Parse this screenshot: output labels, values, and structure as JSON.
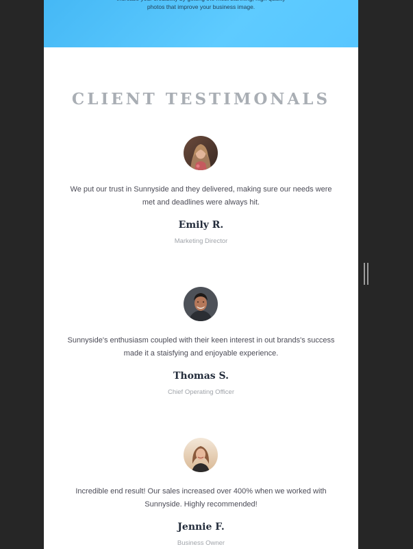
{
  "hero": {
    "text": "Increase your credibility by getting the most stunning, high-quality photos that improve your business image."
  },
  "testimonials_section": {
    "title": "CLIENT TESTIMONALS",
    "items": [
      {
        "quote": "We put our trust in Sunnyside and they delivered, making sure our needs were met and deadlines were always hit.",
        "name": "Emily R.",
        "role": "Marketing Director"
      },
      {
        "quote": "Sunnyside's enthusiasm coupled with their keen interest in out brands's success made it a staisfying and enjoyable experience.",
        "name": "Thomas S.",
        "role": "Chief Operating Officer"
      },
      {
        "quote": "Incredible end result! Our sales increased over 400% when we worked with Sunnyside. Highly recommended!",
        "name": "Jennie F.",
        "role": "Business Owner"
      }
    ]
  },
  "colors": {
    "background": "#262626",
    "hero_blue": "#58c6ff",
    "title_gray": "#a9aeb4",
    "name_dark": "#232c3b",
    "body_text": "#4b4b56",
    "role_gray": "#a0a4aa"
  }
}
